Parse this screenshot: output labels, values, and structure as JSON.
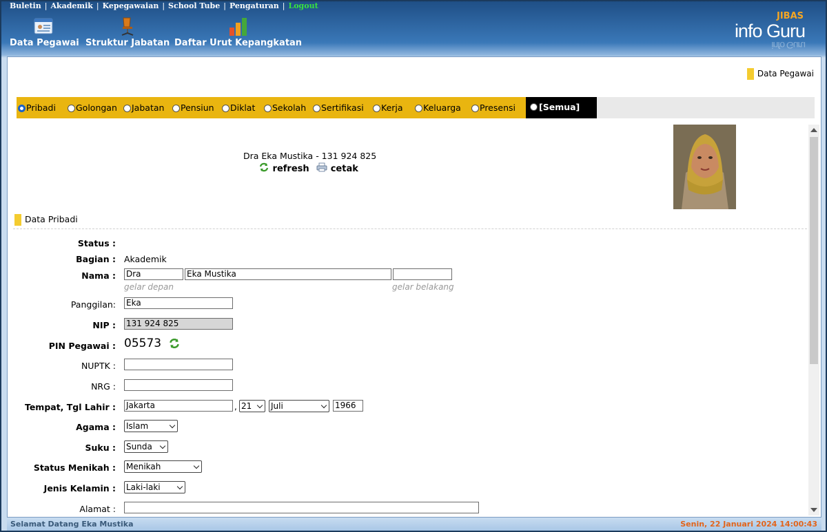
{
  "top_menu": {
    "items": [
      "Buletin",
      "Akademik",
      "Kepegawaian",
      "School Tube",
      "Pengaturan"
    ],
    "logout": "Logout"
  },
  "nav": {
    "data_pegawai": "Data Pegawai",
    "struktur_jabatan": "Struktur Jabatan",
    "daftar_urut": "Daftar Urut Kepangkatan"
  },
  "logo": {
    "small": "JIBAS",
    "main": "info Guru"
  },
  "breadcrumb": "Data Pegawai",
  "tabs": [
    "Pribadi",
    "Golongan",
    "Jabatan",
    "Pensiun",
    "Diklat",
    "Sekolah",
    "Sertifikasi",
    "Kerja",
    "Keluarga",
    "Presensi"
  ],
  "tab_all": "[Semua]",
  "selected_tab": "Pribadi",
  "person_title": "Dra Eka Mustika - 131 924 825",
  "actions": {
    "refresh": "refresh",
    "cetak": "cetak"
  },
  "section_title": "Data Pribadi",
  "form": {
    "status_label": "Status :",
    "bagian_label": "Bagian :",
    "bagian_value": "Akademik",
    "nama_label": "Nama :",
    "gelar_depan": "Dra",
    "nama": "Eka Mustika",
    "gelar_belakang": "",
    "gelar_depan_hint": "gelar depan",
    "gelar_belakang_hint": "gelar belakang",
    "panggilan_label": "Panggilan:",
    "panggilan": "Eka",
    "nip_label": "NIP :",
    "nip": "131 924 825",
    "pin_label": "PIN Pegawai :",
    "pin": "05573",
    "nuptk_label": "NUPTK :",
    "nuptk": "",
    "nrg_label": "NRG :",
    "nrg": "",
    "ttl_label": "Tempat, Tgl Lahir :",
    "tempat": "Jakarta",
    "comma": ",",
    "tgl": "21",
    "bulan": "Juli",
    "tahun": "1966",
    "agama_label": "Agama :",
    "agama": "Islam",
    "suku_label": "Suku :",
    "suku": "Sunda",
    "status_menikah_label": "Status Menikah :",
    "status_menikah": "Menikah",
    "jenis_kelamin_label": "Jenis Kelamin :",
    "jenis_kelamin": "Laki-laki",
    "alamat_label": "Alamat :",
    "alamat": ""
  },
  "footer": {
    "welcome": "Selamat Datang Eka Mustika",
    "datetime": "Senin, 22 Januari 2024 14:00:43"
  },
  "colors": {
    "tab_bar": "#e9b510",
    "accent_yellow": "#f4cc30",
    "logout": "#39e23f",
    "footer_date": "#e2641b"
  }
}
